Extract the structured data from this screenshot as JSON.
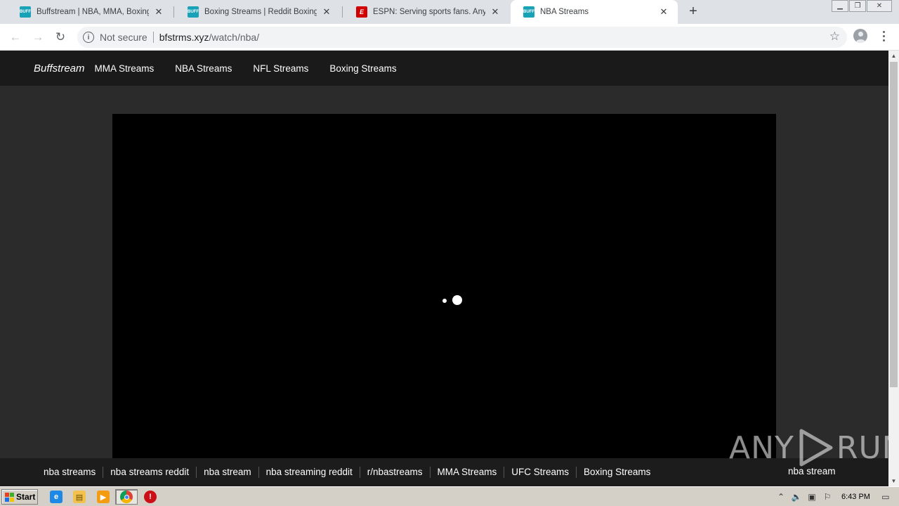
{
  "browser": {
    "tabs": [
      {
        "title": "Buffstream | NBA, MMA, Boxing, NFL",
        "favicon": "buffstream-favicon",
        "active": false
      },
      {
        "title": "Boxing Streams | Reddit Boxing Streams",
        "favicon": "buffstream-favicon",
        "active": false
      },
      {
        "title": "ESPN: Serving sports fans. Anytime.",
        "favicon": "espn-favicon",
        "active": false
      },
      {
        "title": "NBA Streams",
        "favicon": "buffstream-favicon",
        "active": true
      }
    ],
    "favicon_text": {
      "buff": "BUFF",
      "espn": "E"
    },
    "security_label": "Not secure",
    "url_host": "bfstrms.xyz",
    "url_path": "/watch/nba/"
  },
  "site": {
    "brand": "Buffstream",
    "nav": [
      "MMA Streams",
      "NBA Streams",
      "NFL Streams",
      "Boxing Streams"
    ],
    "footer_links": [
      "nba streams",
      "nba streams reddit",
      "nba stream",
      "nba streaming reddit",
      "r/nbastreams",
      "MMA Streams",
      "UFC Streams",
      "Boxing Streams"
    ],
    "footer_right": "nba stream",
    "watermark": {
      "left": "ANY",
      "right": "RUN"
    }
  },
  "taskbar": {
    "start_label": "Start",
    "clock": "6:43 PM"
  },
  "colors": {
    "site_nav_bg": "#1a1a1a",
    "page_bg": "#2b2b2b",
    "player_bg": "#000000",
    "buff_favicon": "#17a2b8",
    "espn_favicon": "#d00000"
  }
}
